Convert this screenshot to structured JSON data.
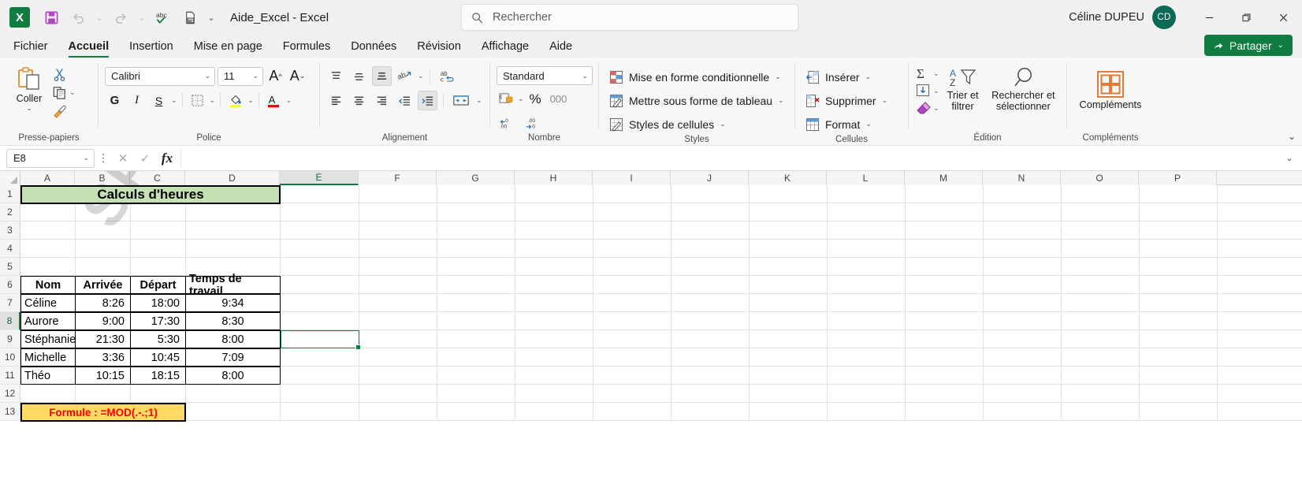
{
  "titlebar": {
    "logo": "X",
    "doc_title": "Aide_Excel  -  Excel",
    "qat": [
      {
        "name": "save",
        "glyph": "save-icon"
      },
      {
        "name": "undo",
        "glyph": "undo-icon"
      },
      {
        "name": "redo",
        "glyph": "redo-icon"
      },
      {
        "name": "spelling",
        "glyph": "spelling-abc-icon"
      },
      {
        "name": "print-preview",
        "glyph": "print-preview-icon"
      },
      {
        "name": "customize-qat",
        "glyph": "chevron-down-icon"
      }
    ],
    "search_placeholder": "Rechercher",
    "user_name": "Céline DUPEU",
    "avatar_initials": "CD",
    "window_minimize": "—",
    "window_restore": "❐",
    "window_close": "✕"
  },
  "tabs": [
    {
      "label": "Fichier",
      "active": false
    },
    {
      "label": "Accueil",
      "active": true
    },
    {
      "label": "Insertion",
      "active": false
    },
    {
      "label": "Mise en page",
      "active": false
    },
    {
      "label": "Formules",
      "active": false
    },
    {
      "label": "Données",
      "active": false
    },
    {
      "label": "Révision",
      "active": false
    },
    {
      "label": "Affichage",
      "active": false
    },
    {
      "label": "Aide",
      "active": false
    }
  ],
  "share": {
    "label": "Partager"
  },
  "ribbon": {
    "groups": [
      {
        "caption": "Presse-papiers"
      },
      {
        "caption": "Police"
      },
      {
        "caption": "Alignement"
      },
      {
        "caption": "Nombre"
      },
      {
        "caption": "Styles"
      },
      {
        "caption": "Cellules"
      },
      {
        "caption": "Édition"
      },
      {
        "caption": "Compléments"
      }
    ],
    "clipboard": {
      "paste_label": "Coller"
    },
    "font": {
      "font_name": "Calibri",
      "font_size": "11",
      "bold": "G",
      "italic": "I",
      "underline": "S",
      "grow_font": "A",
      "shrink_font": "A"
    },
    "number": {
      "format": "Standard",
      "percent": "%",
      "thousands": "000"
    },
    "styles": [
      {
        "label": "Mise en forme conditionnelle"
      },
      {
        "label": "Mettre sous forme de tableau"
      },
      {
        "label": "Styles de cellules"
      }
    ],
    "cells": [
      {
        "label": "Insérer"
      },
      {
        "label": "Supprimer"
      },
      {
        "label": "Format"
      }
    ],
    "editing": [
      {
        "label": "Trier et filtrer"
      },
      {
        "label": "Rechercher et sélectionner"
      }
    ],
    "addins": {
      "label": "Compléments"
    }
  },
  "formula_bar": {
    "name_box": "E8",
    "formula_value": "",
    "cancel": "✕",
    "confirm": "✓",
    "fx": "fx"
  },
  "grid": {
    "columns": [
      "A",
      "B",
      "C",
      "D",
      "E",
      "F",
      "G",
      "H",
      "I",
      "J",
      "K",
      "L",
      "M",
      "N",
      "O",
      "P"
    ],
    "rows": [
      "1",
      "2",
      "3",
      "4",
      "5",
      "6",
      "7",
      "8",
      "9",
      "10",
      "11",
      "12",
      "13"
    ],
    "selected_cell": "E8",
    "selected_column": "E",
    "selected_row": "8",
    "watermark": "SPECIMEN",
    "title_cell": {
      "ref": "A1:D1",
      "text": "Calculs d'heures",
      "fill": "#c5e0b3"
    },
    "table": {
      "headers": [
        "Nom",
        "Arrivée",
        "Départ",
        "Temps de travail"
      ],
      "rows": [
        {
          "nom": "Céline",
          "arrivee": "8:26",
          "depart": "18:00",
          "temps": "9:34"
        },
        {
          "nom": "Aurore",
          "arrivee": "9:00",
          "depart": "17:30",
          "temps": "8:30"
        },
        {
          "nom": "Stéphanie",
          "arrivee": "21:30",
          "depart": "5:30",
          "temps": "8:00"
        },
        {
          "nom": "Michelle",
          "arrivee": "3:36",
          "depart": "10:45",
          "temps": "7:09"
        },
        {
          "nom": "Théo",
          "arrivee": "10:15",
          "depart": "18:15",
          "temps": "8:00"
        }
      ]
    },
    "note_cell": {
      "ref": "A12:C12",
      "text": "Formule : =MOD(.-.;1)",
      "fill": "#ffd966",
      "color": "#ff0000"
    }
  }
}
